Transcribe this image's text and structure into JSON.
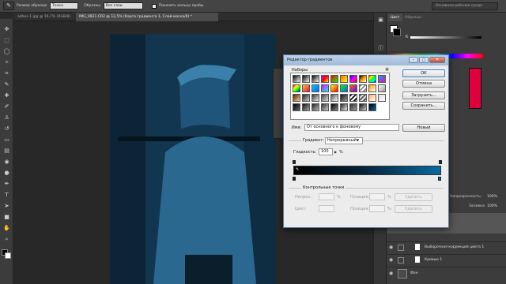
{
  "options_bar": {
    "size_label": "Размер образца:",
    "size_value": "Точка",
    "sample_label": "Образец:",
    "sample_value": "Все слои",
    "show_ring_label": "Показать кольцо пробы",
    "workspace": "Основная рабочая среда"
  },
  "tabs": [
    {
      "label": "adhes-1.jpg @ 16,7% (RGB/8)"
    },
    {
      "label": "IMG_0921.CR2 @ 12,5% (Карта градиента 1, Слой-маска/8) *"
    }
  ],
  "right_panel": {
    "tabs": [
      "Цвет",
      "Образцы"
    ],
    "channel_label": "K",
    "layer_controls": {
      "opacity_label": "Непрозрачность:",
      "opacity_value": "100%",
      "fill_label": "Заливка:",
      "fill_value": "100%"
    },
    "layers": [
      {
        "name": "Выборочная коррекция цвета 1"
      },
      {
        "name": "Кривые 1"
      },
      {
        "name": "Фон"
      }
    ]
  },
  "dialog": {
    "title": "Редактор градиентов",
    "presets_label": "Наборы",
    "buttons": {
      "ok": "ОК",
      "cancel": "Отмена",
      "load": "Загрузить...",
      "save": "Сохранить...",
      "new": "Новый"
    },
    "name_label": "Имя:",
    "name_value": "От основного к фоновому",
    "gradient_type_label": "Градиент:",
    "gradient_type_value": "Непрерывный",
    "smoothness_label": "Гладкость:",
    "smoothness_value": "100",
    "smoothness_unit": "%",
    "stops_label": "Контрольные точки",
    "opacity_label": "Непроз.:",
    "position_label": "Позиция:",
    "color_label": "Цвет:",
    "percent_unit": "%",
    "delete_label": "Удалить"
  },
  "colors": {
    "photo_tint": "#15405c",
    "gradient_end": "#0a6aa0",
    "accent_bar": "#e0003c"
  },
  "icons": {
    "tools": [
      "move-icon",
      "marquee-icon",
      "lasso-icon",
      "quick-select-icon",
      "crop-icon",
      "eyedropper-icon",
      "healing-icon",
      "brush-icon",
      "stamp-icon",
      "history-brush-icon",
      "eraser-icon",
      "gradient-icon",
      "blur-icon",
      "dodge-icon",
      "pen-icon",
      "type-icon",
      "path-select-icon",
      "shape-icon",
      "hand-icon",
      "zoom-icon"
    ]
  }
}
